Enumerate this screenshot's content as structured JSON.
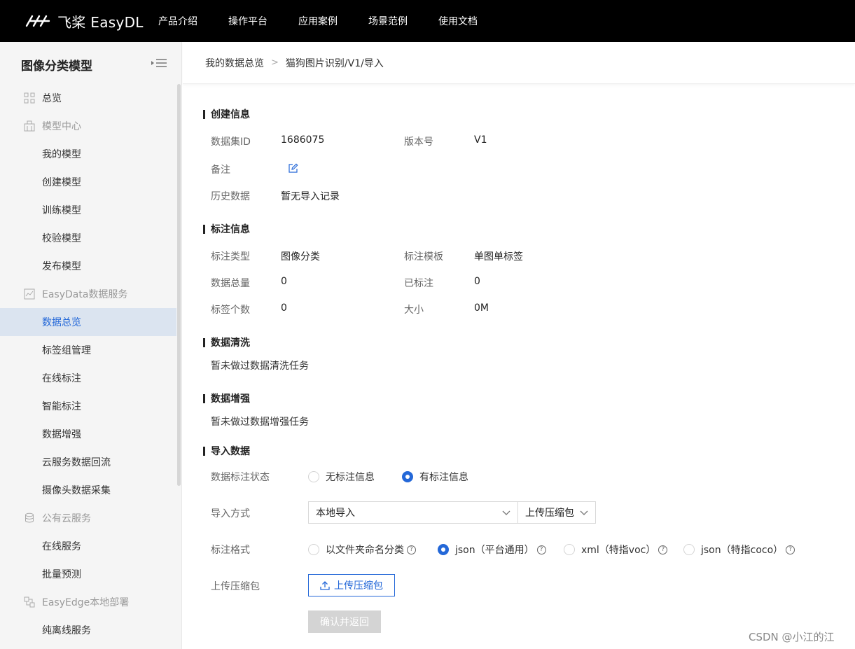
{
  "header": {
    "logo_text": "飞桨 EasyDL",
    "nav": [
      "产品介绍",
      "操作平台",
      "应用案例",
      "场景范例",
      "使用文档"
    ]
  },
  "sidebar": {
    "title": "图像分类模型",
    "items": [
      {
        "label": "总览",
        "kind": "group",
        "icon": "grid-icon"
      },
      {
        "label": "模型中心",
        "kind": "group",
        "icon": "model-center-icon"
      },
      {
        "label": "我的模型",
        "kind": "sub"
      },
      {
        "label": "创建模型",
        "kind": "sub"
      },
      {
        "label": "训练模型",
        "kind": "sub"
      },
      {
        "label": "校验模型",
        "kind": "sub"
      },
      {
        "label": "发布模型",
        "kind": "sub"
      },
      {
        "label": "EasyData数据服务",
        "kind": "group",
        "icon": "chart-icon"
      },
      {
        "label": "数据总览",
        "kind": "sub",
        "active": true
      },
      {
        "label": "标签组管理",
        "kind": "sub"
      },
      {
        "label": "在线标注",
        "kind": "sub"
      },
      {
        "label": "智能标注",
        "kind": "sub"
      },
      {
        "label": "数据增强",
        "kind": "sub"
      },
      {
        "label": "云服务数据回流",
        "kind": "sub"
      },
      {
        "label": "摄像头数据采集",
        "kind": "sub"
      },
      {
        "label": "公有云服务",
        "kind": "group",
        "icon": "database-icon"
      },
      {
        "label": "在线服务",
        "kind": "sub"
      },
      {
        "label": "批量预测",
        "kind": "sub"
      },
      {
        "label": "EasyEdge本地部署",
        "kind": "group",
        "icon": "edge-device-icon"
      },
      {
        "label": "纯离线服务",
        "kind": "sub"
      }
    ]
  },
  "breadcrumb": {
    "parent": "我的数据总览",
    "separator": ">",
    "current": "猫狗图片识别/V1/导入"
  },
  "create_info": {
    "title": "创建信息",
    "dataset_id_label": "数据集ID",
    "dataset_id": "1686075",
    "version_label": "版本号",
    "version": "V1",
    "remark_label": "备注",
    "history_label": "历史数据",
    "history_value": "暂无导入记录"
  },
  "annotation_info": {
    "title": "标注信息",
    "type_label": "标注类型",
    "type_value": "图像分类",
    "template_label": "标注模板",
    "template_value": "单图单标签",
    "total_label": "数据总量",
    "total_value": "0",
    "labeled_label": "已标注",
    "labeled_value": "0",
    "tag_count_label": "标签个数",
    "tag_count_value": "0",
    "size_label": "大小",
    "size_value": "0M"
  },
  "cleaning": {
    "title": "数据清洗",
    "text": "暂未做过数据清洗任务"
  },
  "augment": {
    "title": "数据增强",
    "text": "暂未做过数据增强任务"
  },
  "import": {
    "title": "导入数据",
    "status_label": "数据标注状态",
    "status_options": [
      "无标注信息",
      "有标注信息"
    ],
    "status_selected": 1,
    "method_label": "导入方式",
    "method_value": "本地导入",
    "method_sub_value": "上传压缩包",
    "format_label": "标注格式",
    "format_options": [
      "以文件夹命名分类",
      "json（平台通用）",
      "xml（特指voc）",
      "json（特指coco）"
    ],
    "format_selected": 1,
    "upload_label": "上传压缩包",
    "upload_button": "上传压缩包",
    "confirm_button": "确认并返回"
  },
  "watermark": "CSDN @小江的江",
  "colors": {
    "accent": "#2468d8",
    "topbar": "#000000",
    "sidebar_bg": "#f5f5f5",
    "active_item_bg": "#dbe4f0"
  }
}
